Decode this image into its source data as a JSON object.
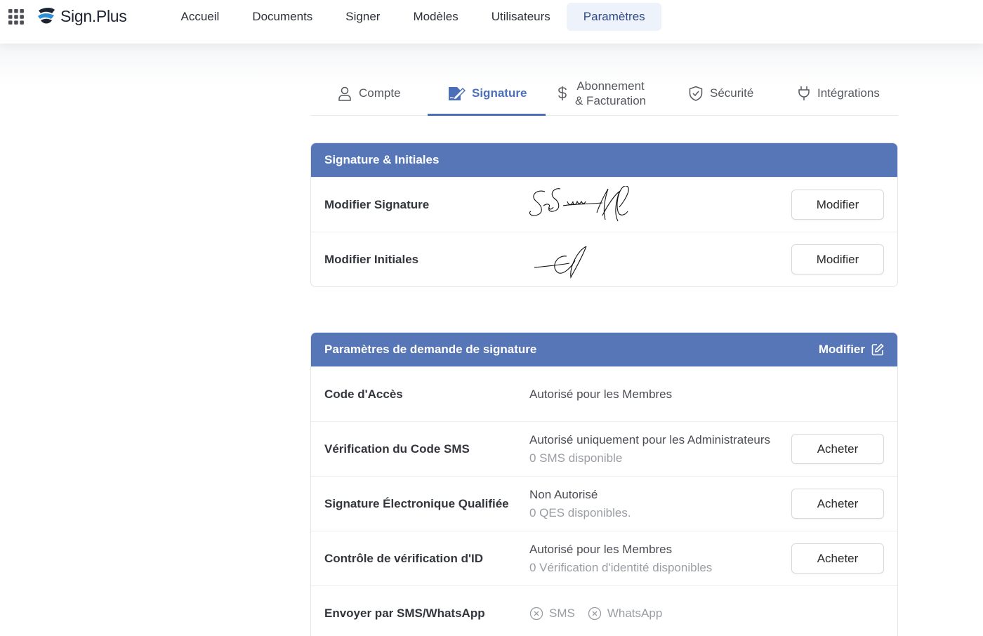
{
  "brand": {
    "name": "Sign.Plus"
  },
  "nav": {
    "items": [
      {
        "label": "Accueil"
      },
      {
        "label": "Documents"
      },
      {
        "label": "Signer"
      },
      {
        "label": "Modèles"
      },
      {
        "label": "Utilisateurs"
      },
      {
        "label": "Paramètres",
        "active": true
      }
    ]
  },
  "tabs": {
    "compte": "Compte",
    "signature": "Signature",
    "abonnement_line1": "Abonnement",
    "abonnement_line2": "& Facturation",
    "securite": "Sécurité",
    "integrations": "Intégrations",
    "active": "Signature"
  },
  "signature_card": {
    "title": "Signature & Initiales",
    "rows": [
      {
        "label": "Modifier Signature",
        "button": "Modifier"
      },
      {
        "label": "Modifier Initiales",
        "button": "Modifier"
      }
    ]
  },
  "request_card": {
    "title": "Paramètres de demande de signature",
    "edit_label": "Modifier",
    "rows": [
      {
        "label": "Code d'Accès",
        "value": "Autorisé pour les Membres"
      },
      {
        "label": "Vérification du Code SMS",
        "value": "Autorisé uniquement pour les Administrateurs",
        "sub": "0 SMS disponible",
        "button": "Acheter"
      },
      {
        "label": "Signature Électronique Qualifiée",
        "value": "Non Autorisé",
        "sub": "0 QES disponibles.",
        "button": "Acheter"
      },
      {
        "label": "Contrôle de vérification d'ID",
        "value": "Autorisé pour les Membres",
        "sub": "0 Vérification d'identité disponibles",
        "button": "Acheter"
      },
      {
        "label": "Envoyer par SMS/WhatsApp",
        "channels": [
          "SMS",
          "WhatsApp"
        ]
      }
    ]
  },
  "colors": {
    "accent": "#5676b8",
    "active_tab": "#4a6fb8",
    "nav_active_bg": "#eef2fb"
  }
}
